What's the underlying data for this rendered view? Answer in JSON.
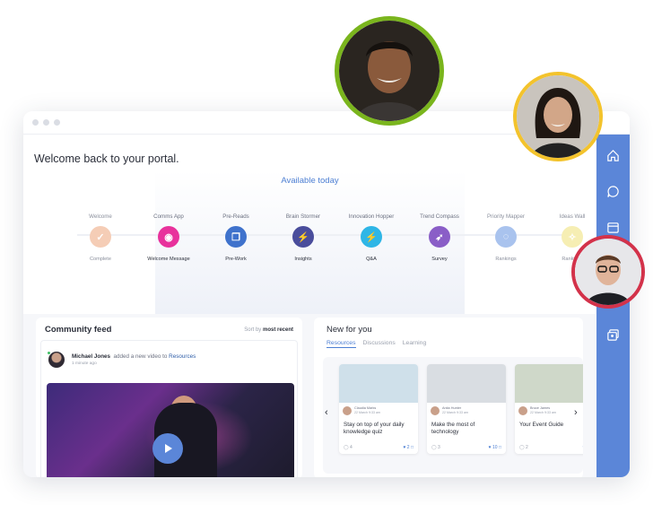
{
  "portal": {
    "welcome": "Welcome back to your portal.",
    "available_today": "Available today",
    "steps": [
      {
        "name": "Welcome",
        "sub": "Complete",
        "color": "#f5cdb6",
        "glyph": "✓",
        "dim": true
      },
      {
        "name": "Comms App",
        "sub": "Welcome Message",
        "color": "#e8329c",
        "glyph": "◉",
        "dim": false
      },
      {
        "name": "Pre-Reads",
        "sub": "Pre-Work",
        "color": "#3f72cc",
        "glyph": "❐",
        "dim": false
      },
      {
        "name": "Brain Stormer",
        "sub": "Insights",
        "color": "#4a4d9c",
        "glyph": "⚡",
        "dim": false
      },
      {
        "name": "Innovation Hopper",
        "sub": "Q&A",
        "color": "#2fb6e6",
        "glyph": "⚡",
        "dim": false
      },
      {
        "name": "Trend Compass",
        "sub": "Survey",
        "color": "#8a5ec7",
        "glyph": "➶",
        "dim": false
      },
      {
        "name": "Priority Mapper",
        "sub": "Rankings",
        "color": "#a9c3ee",
        "glyph": "◌",
        "dim": true
      },
      {
        "name": "Ideas Wall",
        "sub": "Rankings",
        "color": "#f6eeb3",
        "glyph": "✧",
        "dim": true
      }
    ]
  },
  "feed": {
    "title": "Community feed",
    "sort_prefix": "Sort by",
    "sort_value": "most recent",
    "post": {
      "author": "Michael Jones",
      "action": "added a new video to",
      "target": "Resources",
      "time": "1 minute ago"
    }
  },
  "new_for_you": {
    "title": "New for you",
    "tabs": [
      "Resources",
      "Discussions",
      "Learning"
    ],
    "cards": [
      {
        "author": "Claudia Marks",
        "date": "22 March 9:33 am",
        "title": "Stay on top of your daily knowledge quiz",
        "comments": "4",
        "likes": "2",
        "img": "#cfe0ea"
      },
      {
        "author": "Anita Hunter",
        "date": "22 March 9:33 am",
        "title": "Make the most of technology",
        "comments": "3",
        "likes": "10",
        "img": "#d9dde2"
      },
      {
        "author": "Bruce James",
        "date": "22 March 9:33 am",
        "title": "Your Event Guide",
        "comments": "2",
        "likes": "",
        "img": "#cfd8c9"
      }
    ]
  },
  "rail": {
    "icons": [
      "home-icon",
      "chat-icon",
      "calendar-icon",
      "user-icon",
      "contact-card-icon"
    ]
  }
}
